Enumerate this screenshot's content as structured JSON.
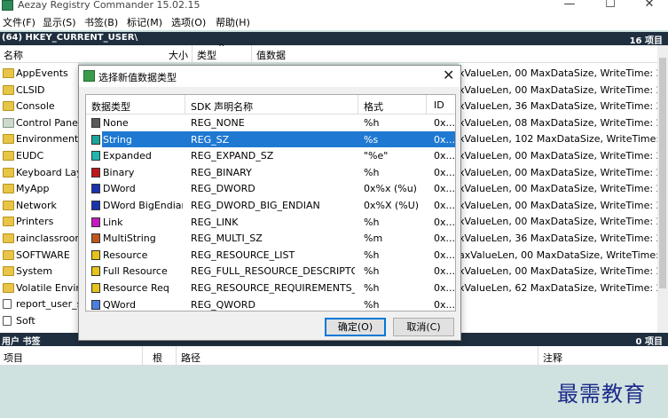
{
  "window": {
    "title": "Aezay Registry Commander 15.02.15",
    "minimize": "—",
    "maximize": "☐",
    "close": "✕"
  },
  "menu": [
    "文件(F)",
    "显示(S)",
    "书签(B)",
    "标记(M)",
    "选项(O)",
    "帮助(H)"
  ],
  "path": {
    "text": "(64) HKEY_CURRENT_USER\\",
    "count": "16 项目"
  },
  "columns": {
    "name": "名称",
    "size": "大小",
    "type": "类型",
    "data": "值数据"
  },
  "keys": [
    {
      "name": "AppEvents",
      "icon": "folder",
      "data": "xValueLen, 00 MaxDataSize, WriteTime: 2"
    },
    {
      "name": "CLSID",
      "icon": "folder",
      "data": "xValueLen, 00 MaxDataSize, WriteTime: 2"
    },
    {
      "name": "Console",
      "icon": "folder",
      "data": "xValueLen, 36 MaxDataSize, WriteTime: 2"
    },
    {
      "name": "Control Panel",
      "icon": "control-panel",
      "data": "xValueLen, 08 MaxDataSize, WriteTime: 2"
    },
    {
      "name": "Environment",
      "icon": "folder",
      "data": "xValueLen, 102 MaxDataSize, WriteTime: 2"
    },
    {
      "name": "EUDC",
      "icon": "folder",
      "data": "xValueLen, 00 MaxDataSize, WriteTime: 2"
    },
    {
      "name": "Keyboard Layout",
      "icon": "folder",
      "data": "xValueLen, 00 MaxDataSize, WriteTime: 2"
    },
    {
      "name": "MyApp",
      "icon": "folder",
      "data": "xValueLen, 00 MaxDataSize, WriteTime: 2"
    },
    {
      "name": "Network",
      "icon": "folder",
      "data": "xValueLen, 00 MaxDataSize, WriteTime: 2"
    },
    {
      "name": "Printers",
      "icon": "folder",
      "data": "xValueLen, 00 MaxDataSize, WriteTime: 2"
    },
    {
      "name": "rainclassroom",
      "icon": "folder",
      "data": "xValueLen, 36 MaxDataSize, WriteTime: 2"
    },
    {
      "name": "SOFTWARE",
      "icon": "folder",
      "data": "axValueLen, 00 MaxDataSize, WriteTime: 2"
    },
    {
      "name": "System",
      "icon": "folder",
      "data": "xValueLen, 00 MaxDataSize, WriteTime: 2"
    },
    {
      "name": "Volatile Environment",
      "icon": "folder",
      "data": "xValueLen, 62 MaxDataSize, WriteTime: 2"
    },
    {
      "name": "report_user_s",
      "icon": "document",
      "data": ""
    },
    {
      "name": "Soft",
      "icon": "document",
      "data": ""
    }
  ],
  "bottom": {
    "bar_left": "用户 书签",
    "bar_right": "0 项目",
    "col_item": "项目",
    "col_root": "根",
    "col_path": "路径",
    "col_note": "注释"
  },
  "watermark": "最需教育",
  "dialog": {
    "title": "选择新值数据类型",
    "headers": {
      "type": "数据类型",
      "sdk": "SDK 声明名称",
      "format": "格式",
      "id": "ID"
    },
    "selected_index": 1,
    "rows": [
      {
        "type": "None",
        "sdk": "REG_NONE",
        "format": "%h",
        "id": "0x...",
        "color": "#5a5a5a"
      },
      {
        "type": "String",
        "sdk": "REG_SZ",
        "format": "%s",
        "id": "0x...",
        "color": "#1aa79a"
      },
      {
        "type": "Expanded",
        "sdk": "REG_EXPAND_SZ",
        "format": "\"%e\"",
        "id": "0x...",
        "color": "#1fb6b0"
      },
      {
        "type": "Binary",
        "sdk": "REG_BINARY",
        "format": "%h",
        "id": "0x...",
        "color": "#c0151a"
      },
      {
        "type": "DWord",
        "sdk": "REG_DWORD",
        "format": "0x%x (%u)",
        "id": "0x...",
        "color": "#1a33b0"
      },
      {
        "type": "DWord BigEndian",
        "sdk": "REG_DWORD_BIG_ENDIAN",
        "format": "0x%X (%U)",
        "id": "0x...",
        "color": "#1a33b0"
      },
      {
        "type": "Link",
        "sdk": "REG_LINK",
        "format": "%h",
        "id": "0x...",
        "color": "#c41ac0"
      },
      {
        "type": "MultiString",
        "sdk": "REG_MULTI_SZ",
        "format": "%m",
        "id": "0x...",
        "color": "#c0581a"
      },
      {
        "type": "Resource",
        "sdk": "REG_RESOURCE_LIST",
        "format": "%h",
        "id": "0x...",
        "color": "#e5c41a"
      },
      {
        "type": "Full Resource",
        "sdk": "REG_FULL_RESOURCE_DESCRIPTOR",
        "format": "%h",
        "id": "0x...",
        "color": "#e5c41a"
      },
      {
        "type": "Resource Req",
        "sdk": "REG_RESOURCE_REQUIREMENTS_...",
        "format": "%h",
        "id": "0x...",
        "color": "#e5c41a"
      },
      {
        "type": "QWord",
        "sdk": "REG_QWORD",
        "format": "%h",
        "id": "0x...",
        "color": "#4a7ee0"
      }
    ],
    "ok": "确定(O)",
    "cancel": "取消(C)"
  }
}
